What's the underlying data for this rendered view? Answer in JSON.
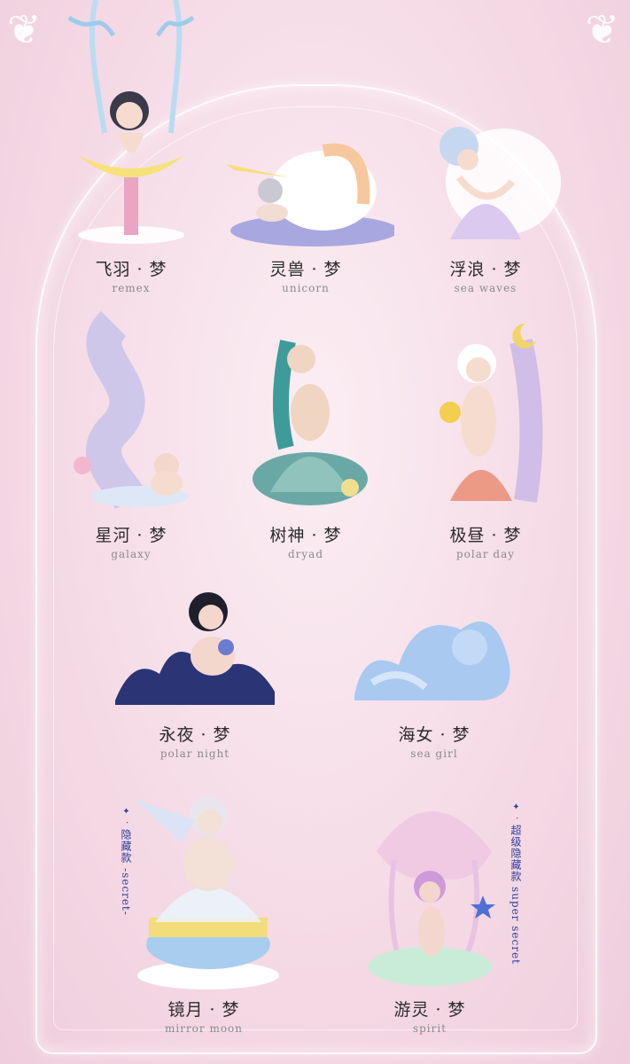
{
  "items": [
    {
      "zh": "飞羽 · 梦",
      "en": "remex"
    },
    {
      "zh": "灵兽 · 梦",
      "en": "unicorn"
    },
    {
      "zh": "浮浪 · 梦",
      "en": "sea waves"
    },
    {
      "zh": "星河 · 梦",
      "en": "galaxy"
    },
    {
      "zh": "树神 · 梦",
      "en": "dryad"
    },
    {
      "zh": "极昼 · 梦",
      "en": "polar day"
    },
    {
      "zh": "永夜 · 梦",
      "en": "polar night"
    },
    {
      "zh": "海女 · 梦",
      "en": "sea girl"
    },
    {
      "zh": "镜月 · 梦",
      "en": "mirror moon"
    },
    {
      "zh": "游灵 · 梦",
      "en": "spirit"
    }
  ],
  "secret": {
    "zh": "隐藏款",
    "en": "-secret-"
  },
  "super_secret": {
    "zh": "超级隐藏款",
    "en": "super secret"
  },
  "sparkle": "✦ ·",
  "colors": {
    "bg": "#f5dbe6",
    "text": "#2b2b2b",
    "subtext": "#8a8a8a",
    "secret_label": "#2b3ea0"
  }
}
